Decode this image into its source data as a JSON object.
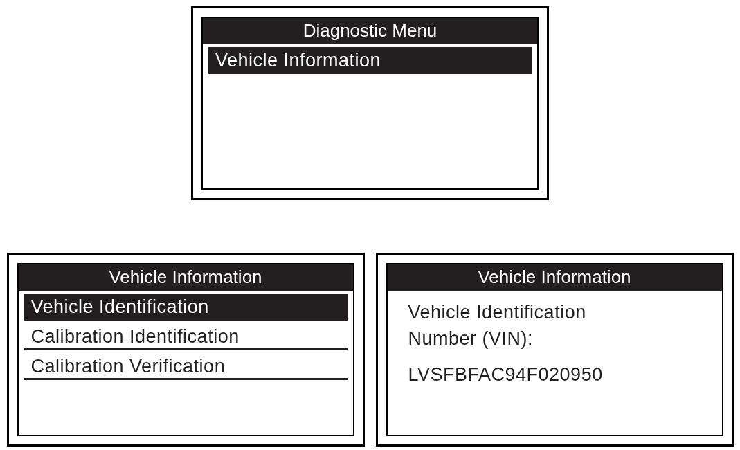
{
  "screens": [
    {
      "title": "Diagnostic Menu",
      "kind": "menu",
      "items": [
        {
          "label": "Vehicle Information",
          "selected": true
        }
      ]
    },
    {
      "title": "Vehicle Information",
      "kind": "menu",
      "items": [
        {
          "label": "Vehicle Identification",
          "selected": true
        },
        {
          "label": "Calibration Identification",
          "selected": false
        },
        {
          "label": "Calibration Verification",
          "selected": false
        }
      ]
    },
    {
      "title": "Vehicle Information",
      "kind": "text",
      "lines": [
        "Vehicle Identification Number (VIN):",
        "LVSFBFAC94F020950"
      ]
    }
  ]
}
